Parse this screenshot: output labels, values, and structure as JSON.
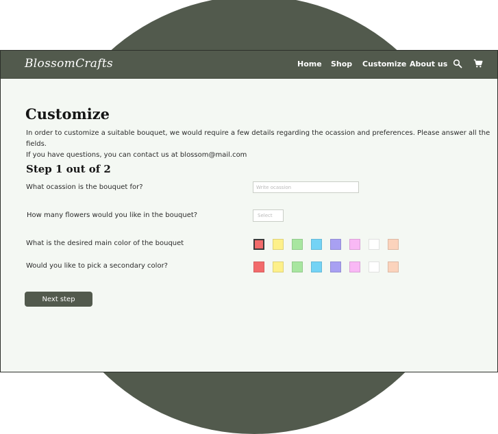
{
  "brand": {
    "logo_text": "BlossomCrafts"
  },
  "nav": {
    "items": [
      {
        "label": "Home"
      },
      {
        "label": "Shop"
      },
      {
        "label": "Customize"
      },
      {
        "label": "About us"
      }
    ],
    "icons": [
      "search-icon",
      "cart-icon"
    ]
  },
  "page": {
    "title": "Customize",
    "intro_line1": "In order to customize a suitable bouquet, we would require a few details regarding the ocassion and preferences. Please answer all the fields.",
    "intro_line2": "If you have questions, you can contact us at blossom@mail.com"
  },
  "step": {
    "title": "Step 1 out of 2"
  },
  "questions": {
    "occasion": {
      "label": "What ocassion is the bouquet for?",
      "placeholder": "Write ocassion"
    },
    "flower_count": {
      "label": "How many flowers would you like in the bouquet?",
      "placeholder": "Select"
    },
    "main_color": {
      "label": "What is the desired main color of the bouquet",
      "selected_index": 0
    },
    "secondary_color": {
      "label": "Would you like to pick a secondary color?"
    }
  },
  "colors": {
    "swatches": [
      "#f26b6b",
      "#fdf08a",
      "#a8e6a0",
      "#74d3f5",
      "#a8a0f2",
      "#f9b8f5",
      "#ffffff",
      "#fbd3bc"
    ],
    "brand": "#525a4d",
    "page_background": "#f4f8f3"
  },
  "actions": {
    "next_label": "Next step"
  }
}
